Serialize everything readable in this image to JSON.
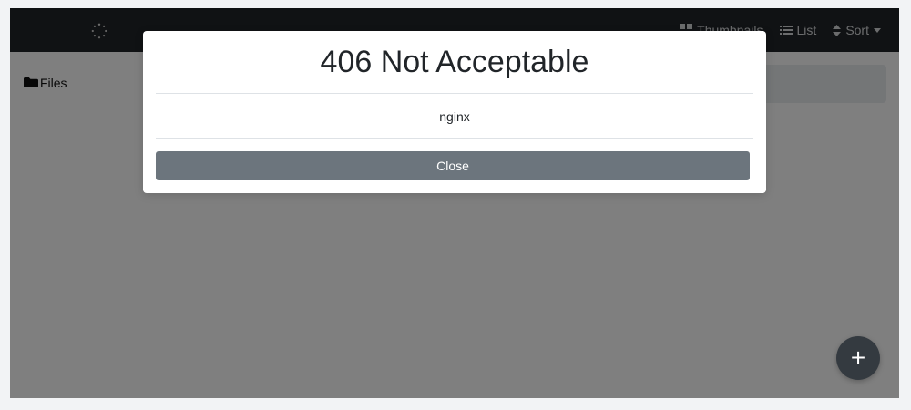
{
  "navbar": {
    "thumbnails_label": "Thumbnails",
    "list_label": "List",
    "sort_label": "Sort"
  },
  "sidebar": {
    "files_label": "Files"
  },
  "modal": {
    "title": "406 Not Acceptable",
    "message": "nginx",
    "close_label": "Close"
  },
  "fab": {
    "label": "+"
  },
  "icons": {
    "spinner": "loading-spinner-icon",
    "thumbnails": "grid-icon",
    "list": "list-icon",
    "sort": "sort-icon",
    "caret": "chevron-down-icon",
    "folder": "folder-icon",
    "plus": "plus-icon"
  },
  "colors": {
    "navbar_background": "#212529",
    "backdrop": "rgba(0,0,0,0.5)",
    "modal_background": "#ffffff",
    "close_button": "#6c757d",
    "fab_background": "#343a40"
  }
}
